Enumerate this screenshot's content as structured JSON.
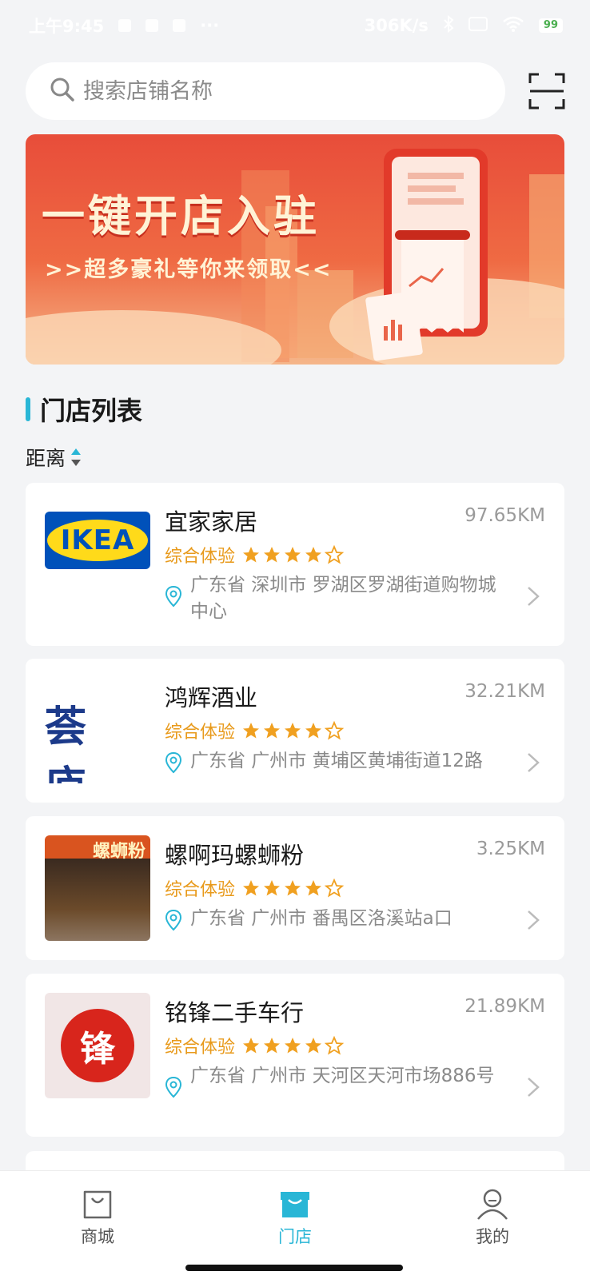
{
  "status_bar": {
    "time": "上午9:45",
    "dots": "···",
    "speed": "306K/s",
    "battery": "99"
  },
  "search": {
    "placeholder": "搜索店铺名称"
  },
  "banner": {
    "title": "一键开店入驻",
    "subtitle": ">>超多豪礼等你来领取<<"
  },
  "section": {
    "title": "门店列表",
    "sort_label": "距离"
  },
  "rating_label": "综合体验",
  "stores": [
    {
      "name": "宜家家居",
      "distance": "97.65KM",
      "stars": 4,
      "address": "广东省 深圳市 罗湖区罗湖街道购物城中心",
      "logo_text": "IKEA"
    },
    {
      "name": "鸿辉酒业",
      "distance": "32.21KM",
      "stars": 4,
      "address": "广东省 广州市 黄埔区黄埔街道12路",
      "logo_text": "荟 庐"
    },
    {
      "name": "螺啊玛螺蛳粉",
      "distance": "3.25KM",
      "stars": 4,
      "address": "广东省 广州市 番禺区洛溪站a口",
      "logo_text": "螺蛳粉"
    },
    {
      "name": "铭锋二手车行",
      "distance": "21.89KM",
      "stars": 4,
      "address": "广东省 广州市 天河区天河市场886号",
      "logo_text": "锋"
    }
  ],
  "tabs": [
    {
      "label": "商城",
      "icon": "bag-icon",
      "active": false
    },
    {
      "label": "门店",
      "icon": "store-icon",
      "active": true
    },
    {
      "label": "我的",
      "icon": "user-icon",
      "active": false
    }
  ],
  "colors": {
    "accent": "#29b6d6",
    "rating": "#e89a1b",
    "banner_red": "#e84d3a"
  }
}
